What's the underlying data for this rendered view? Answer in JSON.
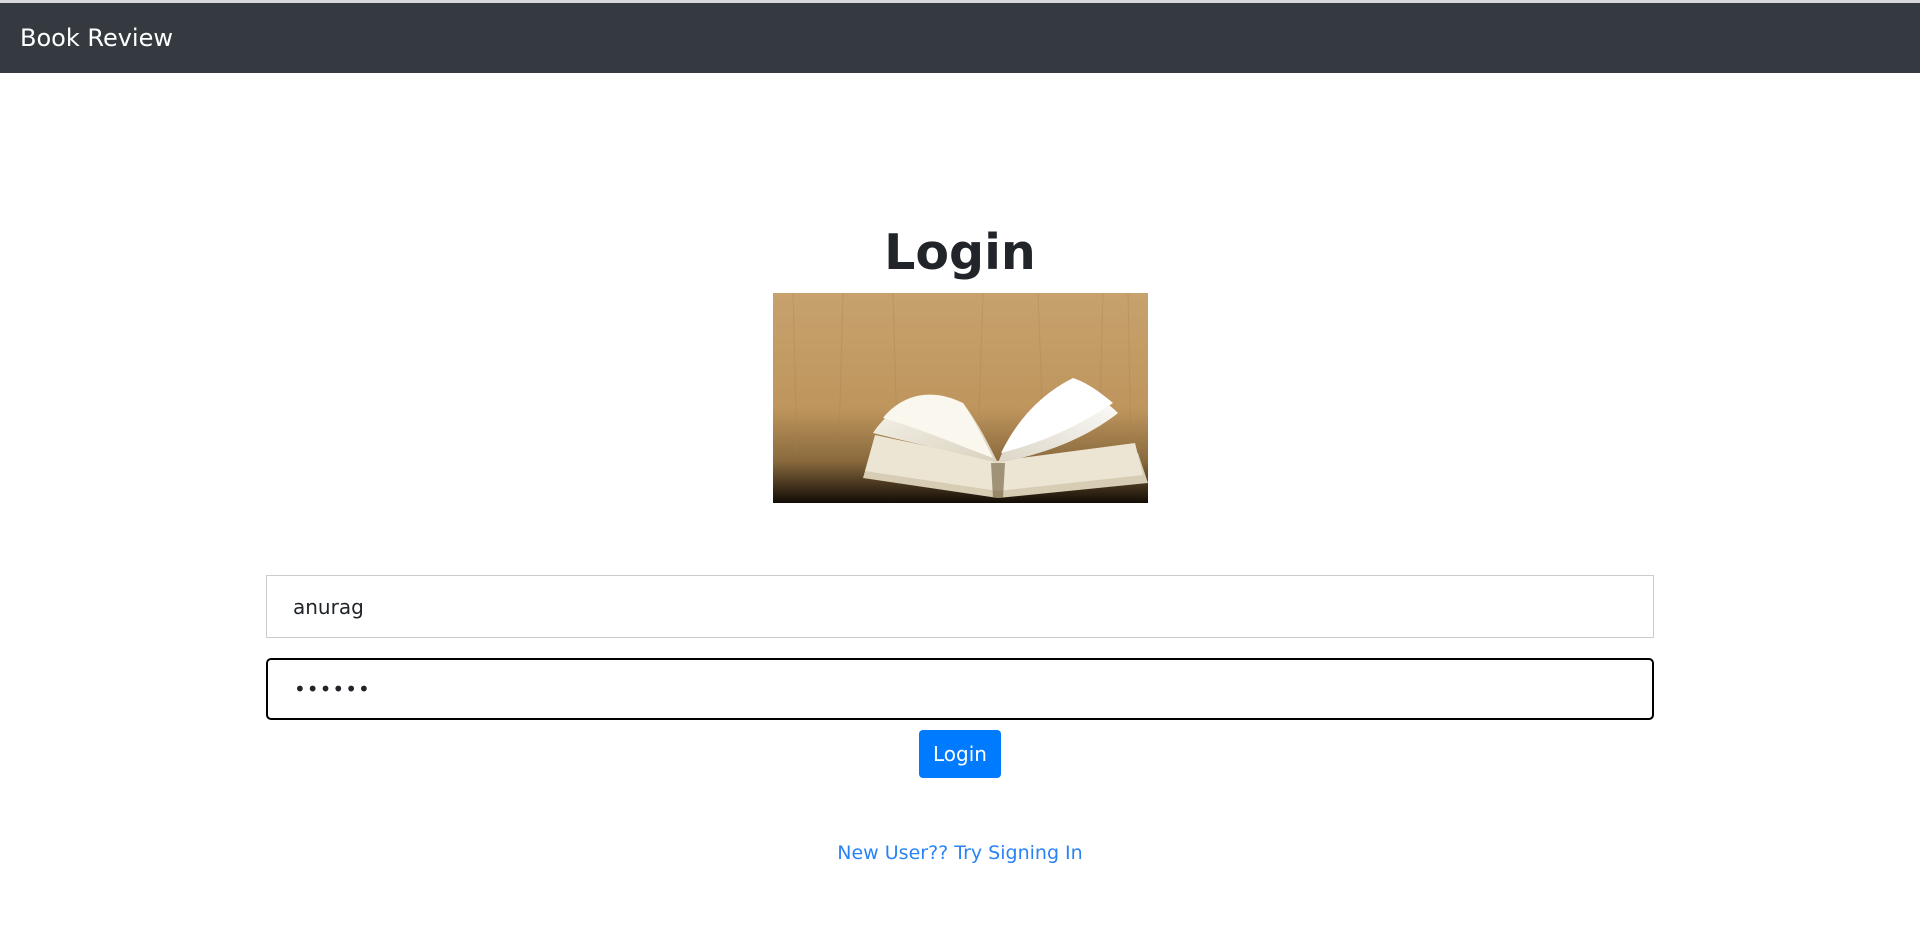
{
  "navbar": {
    "brand": "Book Review",
    "background_color": "#343a40"
  },
  "main": {
    "title": "Login",
    "image": {
      "icon": "open-book-image"
    },
    "username": {
      "value": "anurag"
    },
    "password": {
      "value": "••••••"
    },
    "login_button": {
      "label": "Login",
      "color": "#007bff"
    },
    "signup_link": {
      "label": "New User?? Try Signing In",
      "color": "#2a83f5"
    }
  }
}
